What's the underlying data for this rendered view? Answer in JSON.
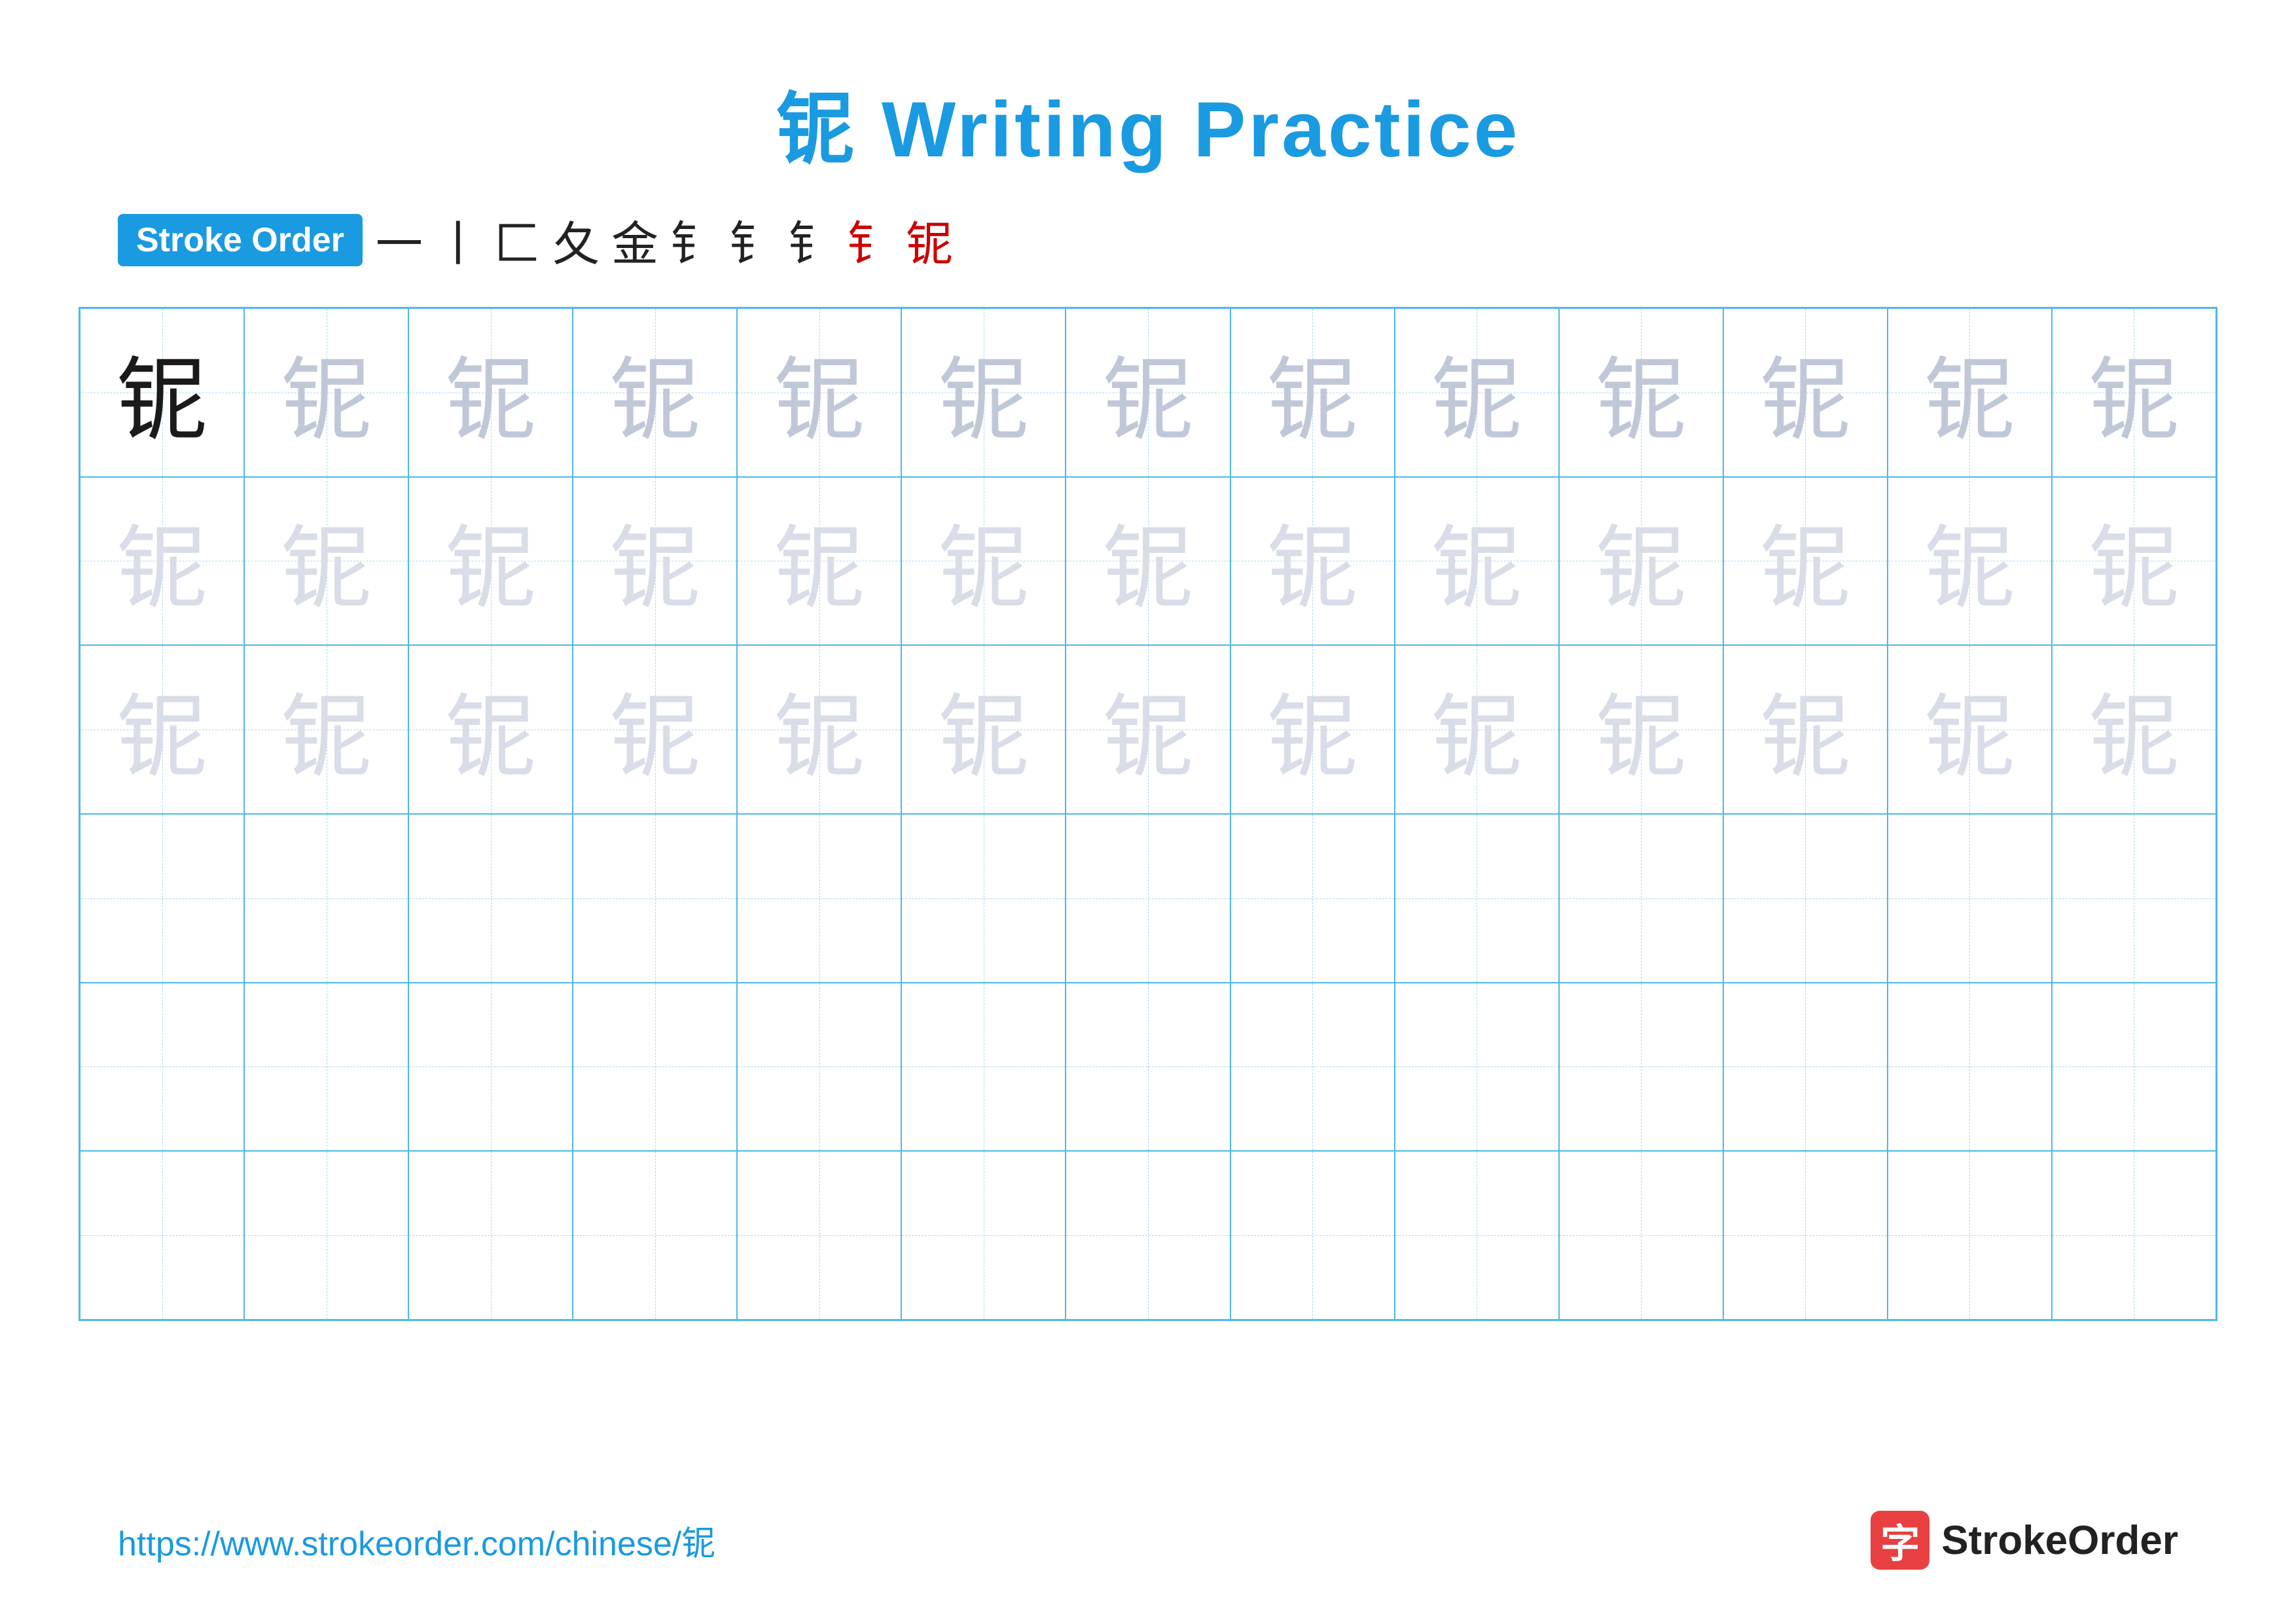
{
  "title": "铌 Writing Practice",
  "stroke_order_label": "Stroke Order",
  "stroke_chars": [
    "⼀",
    "⼁",
    "⼕",
    "⼡",
    "⾦",
    "钅",
    "钅",
    "钅",
    "钅",
    "铌"
  ],
  "character": "铌",
  "rows": [
    {
      "cells": [
        {
          "char": "铌",
          "style": "dark"
        },
        {
          "char": "铌",
          "style": "medium"
        },
        {
          "char": "铌",
          "style": "medium"
        },
        {
          "char": "铌",
          "style": "medium"
        },
        {
          "char": "铌",
          "style": "medium"
        },
        {
          "char": "铌",
          "style": "medium"
        },
        {
          "char": "铌",
          "style": "medium"
        },
        {
          "char": "铌",
          "style": "medium"
        },
        {
          "char": "铌",
          "style": "medium"
        },
        {
          "char": "铌",
          "style": "medium"
        },
        {
          "char": "铌",
          "style": "medium"
        },
        {
          "char": "铌",
          "style": "medium"
        },
        {
          "char": "铌",
          "style": "medium"
        }
      ]
    },
    {
      "cells": [
        {
          "char": "铌",
          "style": "light"
        },
        {
          "char": "铌",
          "style": "light"
        },
        {
          "char": "铌",
          "style": "light"
        },
        {
          "char": "铌",
          "style": "light"
        },
        {
          "char": "铌",
          "style": "light"
        },
        {
          "char": "铌",
          "style": "light"
        },
        {
          "char": "铌",
          "style": "light"
        },
        {
          "char": "铌",
          "style": "light"
        },
        {
          "char": "铌",
          "style": "light"
        },
        {
          "char": "铌",
          "style": "light"
        },
        {
          "char": "铌",
          "style": "light"
        },
        {
          "char": "铌",
          "style": "light"
        },
        {
          "char": "铌",
          "style": "light"
        }
      ]
    },
    {
      "cells": [
        {
          "char": "铌",
          "style": "light"
        },
        {
          "char": "铌",
          "style": "light"
        },
        {
          "char": "铌",
          "style": "light"
        },
        {
          "char": "铌",
          "style": "light"
        },
        {
          "char": "铌",
          "style": "light"
        },
        {
          "char": "铌",
          "style": "light"
        },
        {
          "char": "铌",
          "style": "light"
        },
        {
          "char": "铌",
          "style": "light"
        },
        {
          "char": "铌",
          "style": "light"
        },
        {
          "char": "铌",
          "style": "light"
        },
        {
          "char": "铌",
          "style": "light"
        },
        {
          "char": "铌",
          "style": "light"
        },
        {
          "char": "铌",
          "style": "light"
        }
      ]
    },
    {
      "cells": [
        {
          "char": "",
          "style": "empty"
        },
        {
          "char": "",
          "style": "empty"
        },
        {
          "char": "",
          "style": "empty"
        },
        {
          "char": "",
          "style": "empty"
        },
        {
          "char": "",
          "style": "empty"
        },
        {
          "char": "",
          "style": "empty"
        },
        {
          "char": "",
          "style": "empty"
        },
        {
          "char": "",
          "style": "empty"
        },
        {
          "char": "",
          "style": "empty"
        },
        {
          "char": "",
          "style": "empty"
        },
        {
          "char": "",
          "style": "empty"
        },
        {
          "char": "",
          "style": "empty"
        },
        {
          "char": "",
          "style": "empty"
        }
      ]
    },
    {
      "cells": [
        {
          "char": "",
          "style": "empty"
        },
        {
          "char": "",
          "style": "empty"
        },
        {
          "char": "",
          "style": "empty"
        },
        {
          "char": "",
          "style": "empty"
        },
        {
          "char": "",
          "style": "empty"
        },
        {
          "char": "",
          "style": "empty"
        },
        {
          "char": "",
          "style": "empty"
        },
        {
          "char": "",
          "style": "empty"
        },
        {
          "char": "",
          "style": "empty"
        },
        {
          "char": "",
          "style": "empty"
        },
        {
          "char": "",
          "style": "empty"
        },
        {
          "char": "",
          "style": "empty"
        },
        {
          "char": "",
          "style": "empty"
        }
      ]
    },
    {
      "cells": [
        {
          "char": "",
          "style": "empty"
        },
        {
          "char": "",
          "style": "empty"
        },
        {
          "char": "",
          "style": "empty"
        },
        {
          "char": "",
          "style": "empty"
        },
        {
          "char": "",
          "style": "empty"
        },
        {
          "char": "",
          "style": "empty"
        },
        {
          "char": "",
          "style": "empty"
        },
        {
          "char": "",
          "style": "empty"
        },
        {
          "char": "",
          "style": "empty"
        },
        {
          "char": "",
          "style": "empty"
        },
        {
          "char": "",
          "style": "empty"
        },
        {
          "char": "",
          "style": "empty"
        },
        {
          "char": "",
          "style": "empty"
        }
      ]
    }
  ],
  "footer": {
    "url": "https://www.strokeorder.com/chinese/铌",
    "logo_char": "字",
    "logo_text": "StrokeOrder"
  }
}
